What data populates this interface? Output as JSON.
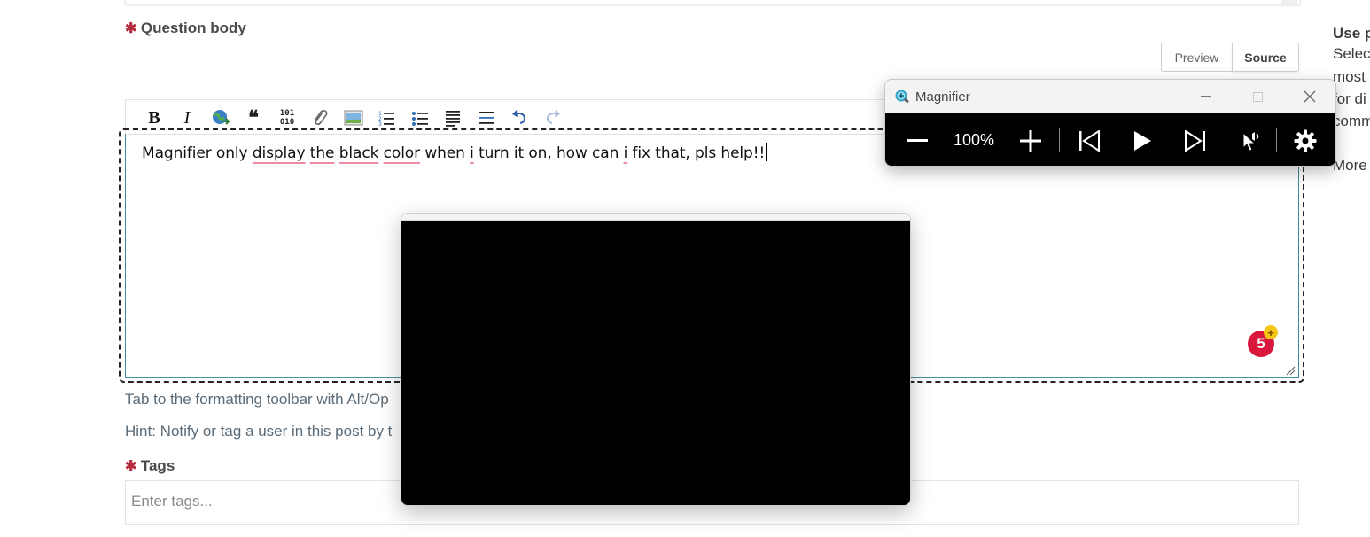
{
  "form": {
    "question_body_label": "Question body",
    "required_mark": "✱",
    "preview_label": "Preview",
    "source_label": "Source",
    "body_text": {
      "w1": "Magnifier only ",
      "w2": "display",
      "w3": " ",
      "w4": "the",
      "w5": " ",
      "w6": "black",
      "w7": " ",
      "w8": "color",
      "w9": " when ",
      "w10": "i",
      "w11": " turn it on, how can ",
      "w12": "i",
      "w13": " fix that, pls help!!"
    },
    "hint_toolbar": "Tab to the formatting toolbar with Alt/Op",
    "hint_notify": "Hint: Notify or tag a user in this post by t",
    "tags_label": "Tags",
    "tags_placeholder": "Enter tags..."
  },
  "toolbar": {
    "bold": "B",
    "italic": "I",
    "quote": "❝",
    "code_top": "101",
    "code_bottom": "010",
    "items": [
      "bold-icon",
      "italic-icon",
      "link-icon",
      "quote-icon",
      "code-icon",
      "attachment-icon",
      "image-icon",
      "numbered-list-icon",
      "bulleted-list-icon",
      "align-icon",
      "horizontal-rule-icon",
      "undo-icon",
      "redo-icon"
    ]
  },
  "badge": {
    "count": "5",
    "plus": "+"
  },
  "sidebar": {
    "line1": "Use p",
    "line2": "Select",
    "line3": "most",
    "line4": "for di",
    "line5": "comm",
    "line6": "More"
  },
  "magnifier": {
    "title": "Magnifier",
    "zoom": "100%"
  },
  "colors": {
    "required": "#b52d3f",
    "editor_border": "#3f8f9a",
    "badge": "#d8173b",
    "spellcheck": "#f08aa0"
  }
}
